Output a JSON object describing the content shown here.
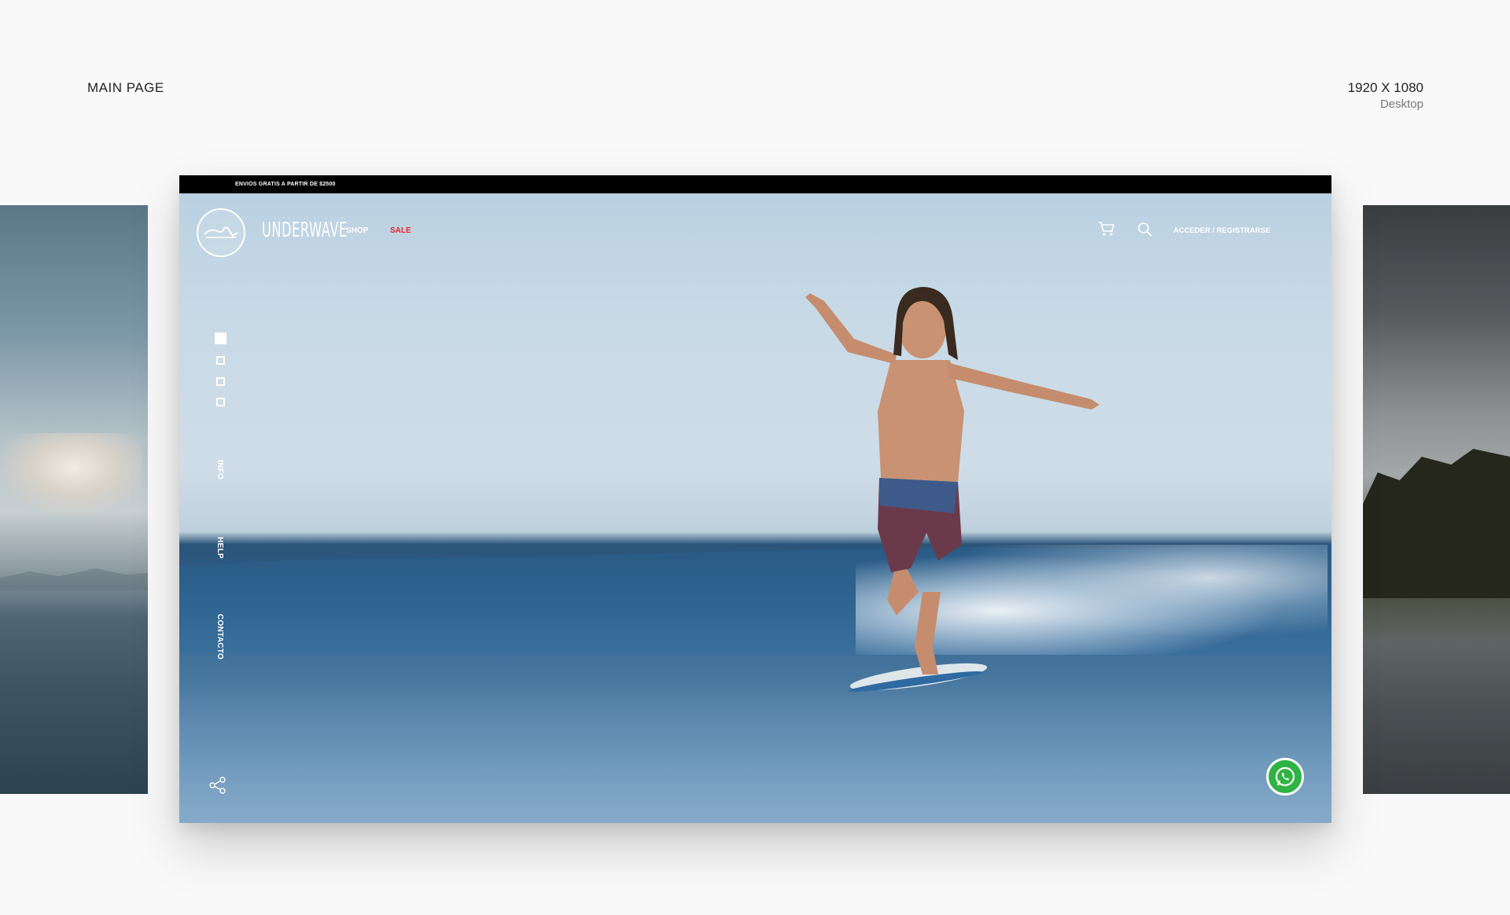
{
  "presentation": {
    "page_title": "MAIN PAGE",
    "resolution": "1920 X 1080",
    "device": "Desktop"
  },
  "site": {
    "topbar_text": "ENVIOS GRATIS A PARTIR DE $2500",
    "brand": "UNDERWAVE",
    "nav": [
      {
        "label": "SHOP",
        "color": "#ffffff"
      },
      {
        "label": "SALE",
        "color": "#e4252c"
      }
    ],
    "account_label": "ACCEDER / REGISTRARSE",
    "slides": {
      "count": 4,
      "active_index": 0
    },
    "side_links": [
      "INFO",
      "HELP",
      "CONTACTO"
    ],
    "icons": {
      "cart": "cart-icon",
      "search": "search-icon",
      "share": "share-icon",
      "whatsapp": "whatsapp-icon",
      "logo": "wave-logo-icon"
    },
    "colors": {
      "sale": "#e4252c",
      "whatsapp": "#2fb344",
      "topbar": "#000000"
    }
  }
}
